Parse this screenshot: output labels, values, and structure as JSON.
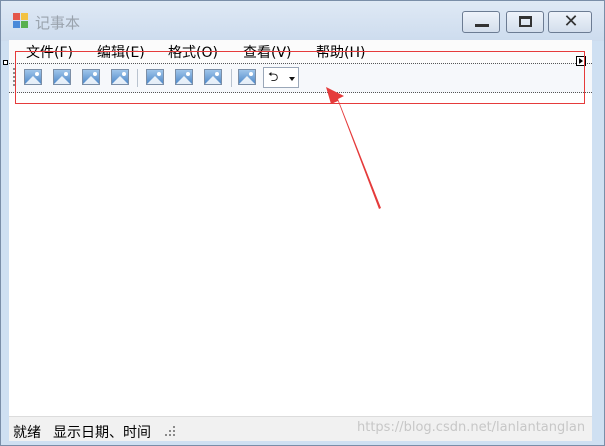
{
  "window": {
    "title": "记事本",
    "minimize_icon": "minimize-icon",
    "maximize_icon": "maximize-icon",
    "close_glyph": "✕"
  },
  "menubar": {
    "items": [
      {
        "label": "文件(F)"
      },
      {
        "label": "编辑(E)"
      },
      {
        "label": "格式(O)"
      },
      {
        "label": "查看(V)"
      },
      {
        "label": "帮助(H)"
      }
    ]
  },
  "toolbar": {
    "button_icon": "image-placeholder-icon",
    "dropdown_icon": "rotate-icon",
    "dropdown_glyph": "⮌"
  },
  "annotation": {
    "box_color": "#e53b3b",
    "arrow_color": "#e53b3b"
  },
  "statusbar": {
    "ready_label": "就绪",
    "datetime_label": "显示日期、时间"
  },
  "watermark": {
    "text": "https://blog.csdn.net/lanlantanglan"
  }
}
